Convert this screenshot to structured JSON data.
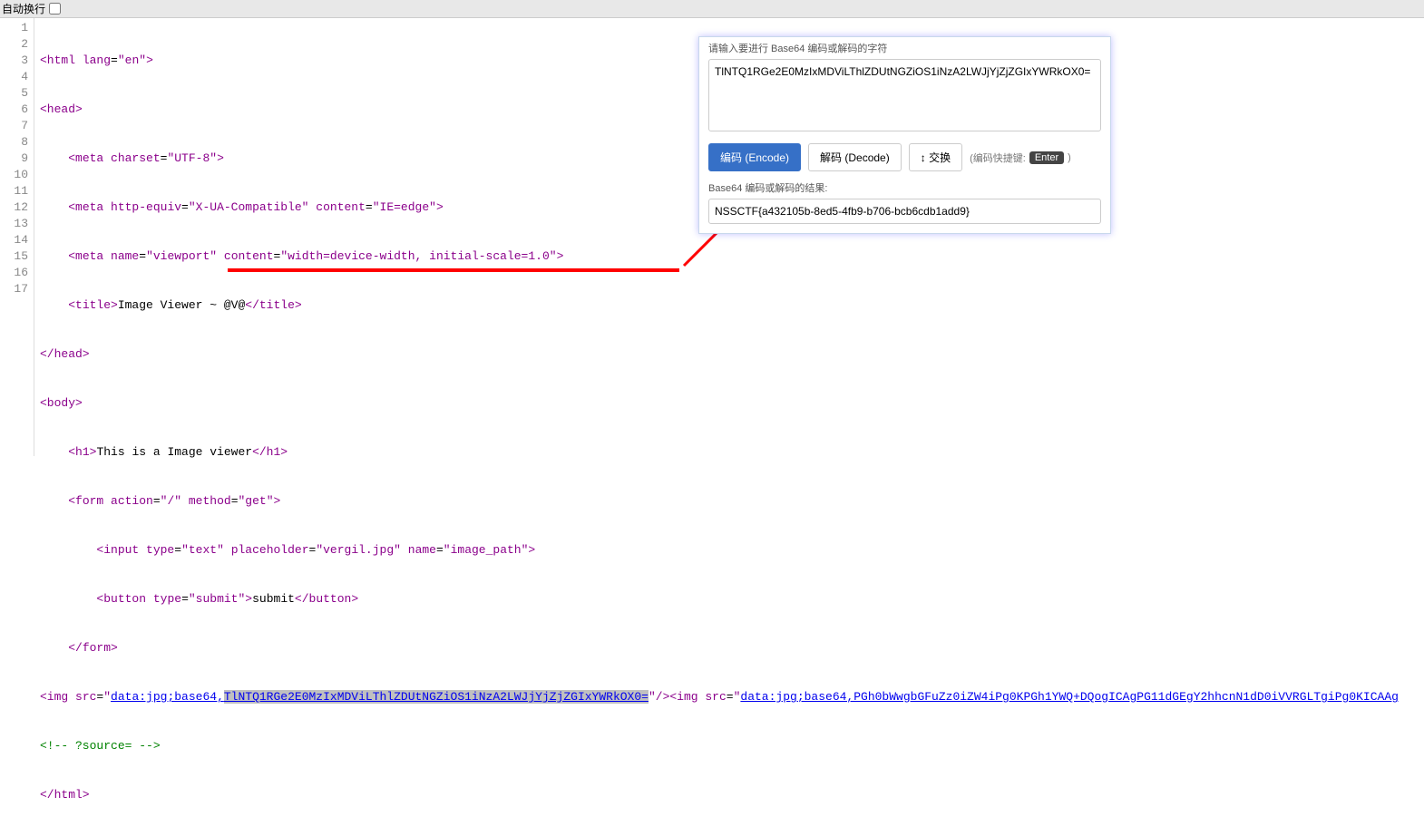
{
  "topbar": {
    "wrap_label": "自动换行"
  },
  "gutter": [
    "1",
    "2",
    "3",
    "4",
    "5",
    "6",
    "7",
    "8",
    "9",
    "10",
    "11",
    "12",
    "13",
    "14",
    "15",
    "16",
    "17"
  ],
  "code": {
    "l1": {
      "a": "<html ",
      "b": "lang",
      "c": "=",
      "d": "\"en\"",
      "e": ">"
    },
    "l2": {
      "a": "<head>"
    },
    "l3": {
      "pad": "    ",
      "a": "<meta ",
      "b": "charset",
      "c": "=",
      "d": "\"UTF-8\"",
      "e": ">"
    },
    "l4": {
      "pad": "    ",
      "a": "<meta ",
      "b": "http-equiv",
      "c": "=",
      "d": "\"X-UA-Compatible\"",
      "e": " ",
      "f": "content",
      "g": "=",
      "h": "\"IE=edge\"",
      "i": ">"
    },
    "l5": {
      "pad": "    ",
      "a": "<meta ",
      "b": "name",
      "c": "=",
      "d": "\"viewport\"",
      "e": " ",
      "f": "content",
      "g": "=",
      "h": "\"width=device-width, initial-scale=1.0\"",
      "i": ">"
    },
    "l6": {
      "pad": "    ",
      "a": "<title>",
      "b": "Image Viewer ~ @V@",
      "c": "</title>"
    },
    "l7": {
      "a": "</head>"
    },
    "l8": {
      "a": "<body>"
    },
    "l9": {
      "pad": "    ",
      "a": "<h1>",
      "b": "This is a Image viewer",
      "c": "</h1>"
    },
    "l10": {
      "pad": "    ",
      "a": "<form ",
      "b": "action",
      "c": "=",
      "d": "\"/\"",
      "e": " ",
      "f": "method",
      "g": "=",
      "h": "\"get\"",
      "i": ">"
    },
    "l11": {
      "pad": "        ",
      "a": "<input ",
      "b": "type",
      "c": "=",
      "d": "\"text\"",
      "e": " ",
      "f": "placeholder",
      "g": "=",
      "h": "\"vergil.jpg\"",
      "i": " ",
      "j": "name",
      "k": "=",
      "l": "\"image_path\"",
      "m": ">"
    },
    "l12": {
      "pad": "        ",
      "a": "<button ",
      "b": "type",
      "c": "=",
      "d": "\"submit\"",
      "e": ">",
      "f": "submit",
      "g": "</button>"
    },
    "l13": {
      "pad": "    ",
      "a": "</form>"
    },
    "l14": {
      "a": "<img ",
      "b": "src",
      "c": "=",
      "q1": "\"",
      "url1a": "data:jpg;base64,",
      "url1b": "TlNTQ1RGe2E0MzIxMDViLThlZDUtNGZiOS1iNzA2LWJjYjZjZGIxYWRkOX0=",
      "q2": "\"",
      "d": "/><img ",
      "e": "src",
      "f": "=",
      "q3": "\"",
      "url2": "data:jpg;base64,PGh0bWwgbGFuZz0iZW4iPg0KPGh1YWQ+DQogICAgPG11dGEgY2hhcnN1dD0iVVRGLTgiPg0KICAAg"
    },
    "l15": {
      "a": "<!-- ?source= -->"
    },
    "l16": {
      "a": "</html>"
    }
  },
  "popup": {
    "title": "请输入要进行 Base64 编码或解码的字符",
    "textarea_value": "TlNTQ1RGe2E0MzIxMDViLThlZDUtNGZiOS1iNzA2LWJjYjZjZGIxYWRkOX0=",
    "encode_btn": "编码 (Encode)",
    "decode_btn": "解码 (Decode)",
    "swap_btn": "↕ 交换",
    "shortcut_hint": "(编码快捷键: ",
    "shortcut_key": "Enter",
    "shortcut_hint2": ")",
    "result_label": "Base64 编码或解码的结果:",
    "result_value": "NSSCTF{a432105b-8ed5-4fb9-b706-bcb6cdb1add9}"
  }
}
